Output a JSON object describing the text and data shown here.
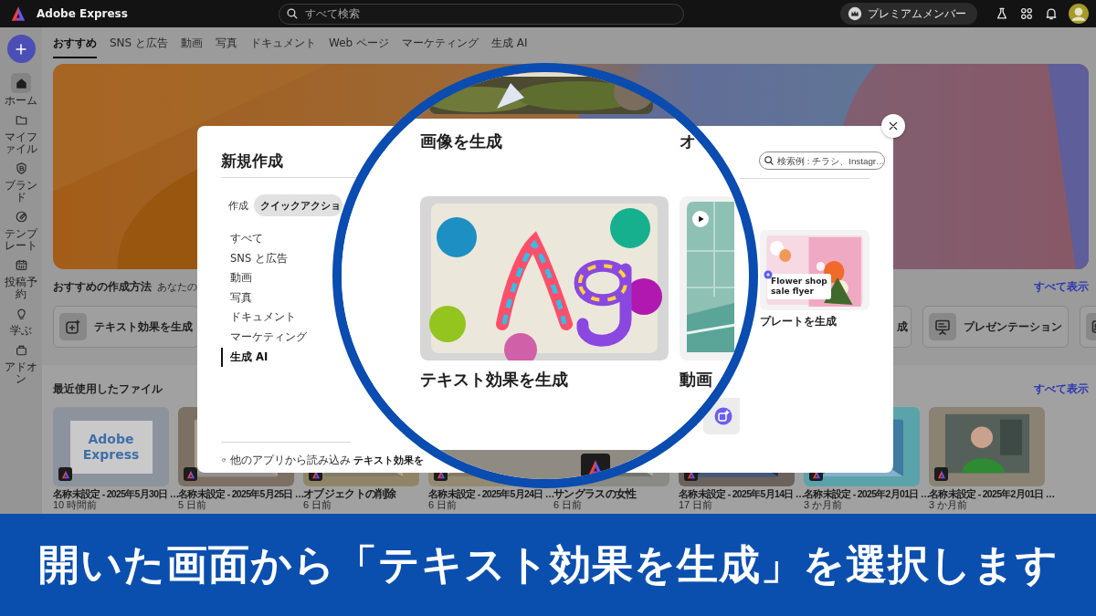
{
  "topbar": {
    "app_name": "Adobe Express",
    "search": {
      "placeholder": "すべて検索"
    },
    "premium_button": "プレミアムメンバー"
  },
  "rail": {
    "items": [
      {
        "label": "ホーム",
        "selected": true
      },
      {
        "label": "マイファイル",
        "selected": false
      },
      {
        "label": "ブランド",
        "selected": false
      },
      {
        "label": "テンプレート",
        "selected": false
      },
      {
        "label": "投稿予約",
        "selected": false
      },
      {
        "label": "学ぶ",
        "selected": false
      },
      {
        "label": "アドオン",
        "selected": false
      }
    ]
  },
  "nav_tabs": [
    {
      "label": "おすすめ",
      "selected": true
    },
    {
      "label": "SNS と広告",
      "selected": false
    },
    {
      "label": "動画",
      "selected": false
    },
    {
      "label": "写真",
      "selected": false
    },
    {
      "label": "ドキュメント",
      "selected": false
    },
    {
      "label": "Web ページ",
      "selected": false
    },
    {
      "label": "マーケティング",
      "selected": false
    },
    {
      "label": "生成 AI",
      "selected": false
    }
  ],
  "quick_actions": {
    "title": "おすすめの作成方法",
    "subtitle": "あなたの",
    "see_all": "すべて表示",
    "cards": [
      {
        "kind": "full",
        "label": "テキスト効果を生成"
      },
      {
        "kind": "label-only",
        "label": "成"
      },
      {
        "kind": "full",
        "label": "プレゼンテーション"
      },
      {
        "kind": "icon-only"
      }
    ]
  },
  "recent_files": {
    "title": "最近使用したファイル",
    "see_all": "すべて表示",
    "files": [
      {
        "name": "名称未設定 - 2025年5月30日 …",
        "time": "10 時間前",
        "thumbnail_text": "Adobe Express"
      },
      {
        "name": "名称未設定 - 2025年5月25日 …",
        "time": "5 日前"
      },
      {
        "name": "オブジェクトの削除",
        "time": "6 日前"
      },
      {
        "name": "名称未設定 - 2025年5月24日 …",
        "time": "6 日前"
      },
      {
        "name": "サングラスの女性",
        "time": "6 日前"
      },
      {
        "name": "名称未設定 - 2025年5月14日 …",
        "time": "17 日前"
      },
      {
        "name": "名称未設定 - 2025年2月01日 …",
        "time": "3 か月前"
      },
      {
        "name": "名称未設定 - 2025年2月01日 …",
        "time": "3 か月前"
      }
    ]
  },
  "dialog": {
    "title": "新規作成",
    "modes": [
      {
        "label": "作成",
        "selected": false
      },
      {
        "label": "クイックアクショ",
        "selected": true
      }
    ],
    "categories": [
      {
        "label": "すべて",
        "selected": false
      },
      {
        "label": "SNS と広告",
        "selected": false
      },
      {
        "label": "動画",
        "selected": false
      },
      {
        "label": "写真",
        "selected": false
      },
      {
        "label": "ドキュメント",
        "selected": false
      },
      {
        "label": "マーケティング",
        "selected": false
      },
      {
        "label": "生成 AI",
        "selected": true
      }
    ],
    "import_link": "他のアプリから読み込み",
    "search": {
      "placeholder": "検索例 : チラシ、Instagr…"
    },
    "template_card": {
      "badge": "Flower shop sale flyer",
      "label": "プレートを生成"
    },
    "small_card": {
      "label": "テキスト効果を"
    }
  },
  "magnifier": {
    "section_titles": [
      "画像を生成",
      "オ"
    ],
    "cards": [
      {
        "label": "テキスト効果を生成"
      },
      {
        "kind": "video",
        "label": "動画"
      }
    ]
  },
  "caption": "開いた画面から「テキスト効果を生成」を選択します"
}
